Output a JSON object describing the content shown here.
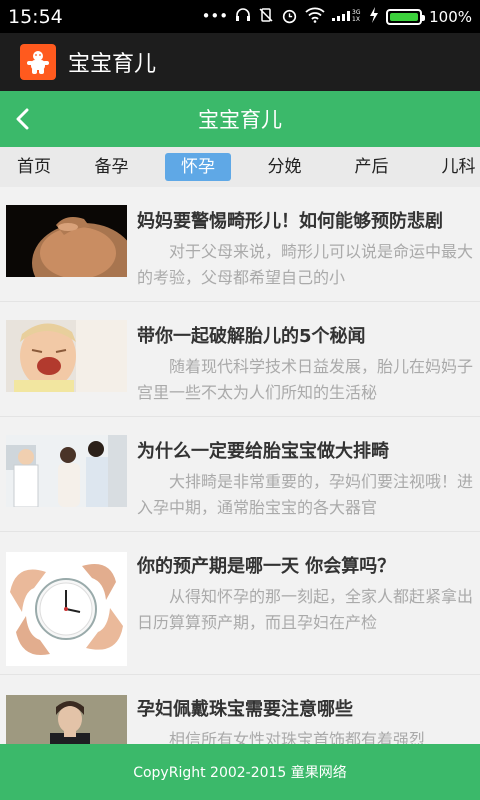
{
  "status": {
    "time": "15:54",
    "network": "3G 1X",
    "battery": "100%",
    "battery_level": 1.0
  },
  "app": {
    "name": "宝宝育儿"
  },
  "header": {
    "title": "宝宝育儿"
  },
  "tabs": [
    {
      "label": "首页"
    },
    {
      "label": "备孕"
    },
    {
      "label": "怀孕",
      "active": true
    },
    {
      "label": "分娩"
    },
    {
      "label": "产后"
    },
    {
      "label": "儿科"
    }
  ],
  "articles": [
    {
      "title": "妈妈要警惕畸形儿！如何能够预防悲剧",
      "desc": "对于父母来说，畸形儿可以说是命运中最大的考验，父母都希望自己的小"
    },
    {
      "title": "带你一起破解胎儿的5个秘闻",
      "desc": "随着现代科学技术日益发展，胎儿在妈妈子宫里一些不太为人们所知的生活秘"
    },
    {
      "title": "为什么一定要给胎宝宝做大排畸",
      "desc": "大排畸是非常重要的，孕妈们要注视哦！进入孕中期，通常胎宝宝的各大器官"
    },
    {
      "title": "你的预产期是哪一天 你会算吗？",
      "desc": "从得知怀孕的那一刻起，全家人都赶紧拿出日历算算预产期，而且孕妇在产检"
    },
    {
      "title": "孕妇佩戴珠宝需要注意哪些",
      "desc": "相信所有女性对珠宝首饰都有着强烈"
    }
  ],
  "footer": {
    "copyright": "CopyRight 2002-2015 童果网络"
  },
  "colors": {
    "green": "#3bb96a",
    "tab_active": "#5fa8e6",
    "app_icon": "#ff5a1e"
  }
}
